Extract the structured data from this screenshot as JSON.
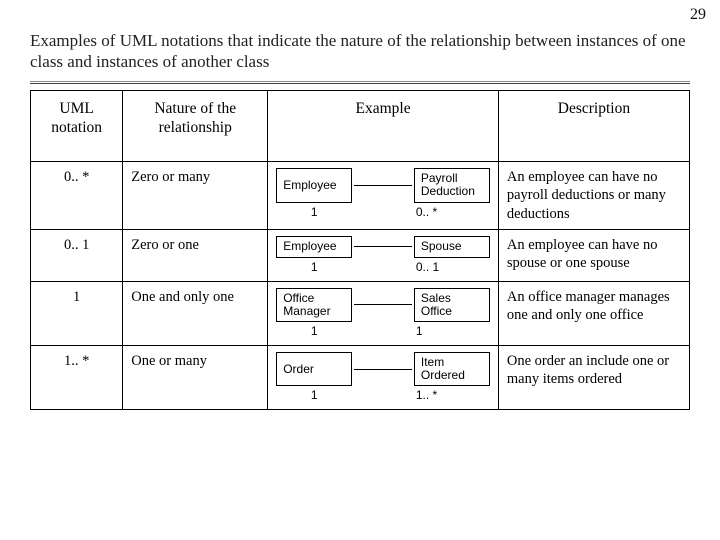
{
  "page_number": "29",
  "title": "Examples of UML notations that indicate the nature of the relationship between instances of one class and instances of another class",
  "headers": {
    "notation": "UML notation",
    "nature": "Nature of the relationship",
    "example": "Example",
    "description": "Description"
  },
  "rows": [
    {
      "notation": "0.. *",
      "nature": "Zero or many",
      "example": {
        "left": "Employee",
        "right": "Payroll Deduction",
        "mult_left": "1",
        "mult_right": "0.. *"
      },
      "description": "An employee can have no payroll deductions or many deductions"
    },
    {
      "notation": "0.. 1",
      "nature": "Zero or one",
      "example": {
        "left": "Employee",
        "right": "Spouse",
        "mult_left": "1",
        "mult_right": "0.. 1"
      },
      "description": "An employee can have no spouse or one spouse"
    },
    {
      "notation": "1",
      "nature": "One and only one",
      "example": {
        "left": "Office Manager",
        "right": "Sales Office",
        "mult_left": "1",
        "mult_right": "1"
      },
      "description": "An office manager manages one and only one office"
    },
    {
      "notation": "1.. *",
      "nature": "One or many",
      "example": {
        "left": "Order",
        "right": "Item Ordered",
        "mult_left": "1",
        "mult_right": "1.. *"
      },
      "description": "One order an include one or many items ordered"
    }
  ]
}
